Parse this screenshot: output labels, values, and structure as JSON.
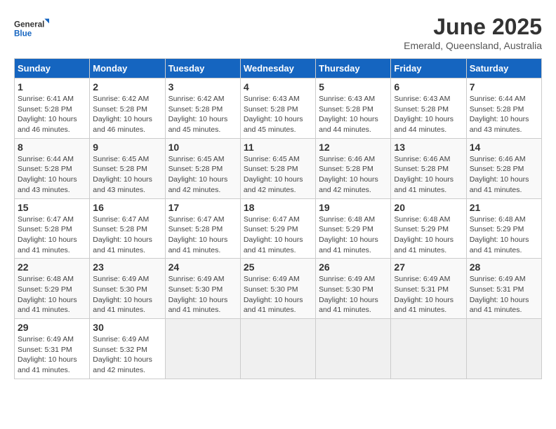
{
  "logo": {
    "general": "General",
    "blue": "Blue"
  },
  "title": "June 2025",
  "location": "Emerald, Queensland, Australia",
  "weekdays": [
    "Sunday",
    "Monday",
    "Tuesday",
    "Wednesday",
    "Thursday",
    "Friday",
    "Saturday"
  ],
  "weeks": [
    [
      {
        "day": "1",
        "sunrise": "6:41 AM",
        "sunset": "5:28 PM",
        "daylight": "10 hours and 46 minutes."
      },
      {
        "day": "2",
        "sunrise": "6:42 AM",
        "sunset": "5:28 PM",
        "daylight": "10 hours and 46 minutes."
      },
      {
        "day": "3",
        "sunrise": "6:42 AM",
        "sunset": "5:28 PM",
        "daylight": "10 hours and 45 minutes."
      },
      {
        "day": "4",
        "sunrise": "6:43 AM",
        "sunset": "5:28 PM",
        "daylight": "10 hours and 45 minutes."
      },
      {
        "day": "5",
        "sunrise": "6:43 AM",
        "sunset": "5:28 PM",
        "daylight": "10 hours and 44 minutes."
      },
      {
        "day": "6",
        "sunrise": "6:43 AM",
        "sunset": "5:28 PM",
        "daylight": "10 hours and 44 minutes."
      },
      {
        "day": "7",
        "sunrise": "6:44 AM",
        "sunset": "5:28 PM",
        "daylight": "10 hours and 43 minutes."
      }
    ],
    [
      {
        "day": "8",
        "sunrise": "6:44 AM",
        "sunset": "5:28 PM",
        "daylight": "10 hours and 43 minutes."
      },
      {
        "day": "9",
        "sunrise": "6:45 AM",
        "sunset": "5:28 PM",
        "daylight": "10 hours and 43 minutes."
      },
      {
        "day": "10",
        "sunrise": "6:45 AM",
        "sunset": "5:28 PM",
        "daylight": "10 hours and 42 minutes."
      },
      {
        "day": "11",
        "sunrise": "6:45 AM",
        "sunset": "5:28 PM",
        "daylight": "10 hours and 42 minutes."
      },
      {
        "day": "12",
        "sunrise": "6:46 AM",
        "sunset": "5:28 PM",
        "daylight": "10 hours and 42 minutes."
      },
      {
        "day": "13",
        "sunrise": "6:46 AM",
        "sunset": "5:28 PM",
        "daylight": "10 hours and 41 minutes."
      },
      {
        "day": "14",
        "sunrise": "6:46 AM",
        "sunset": "5:28 PM",
        "daylight": "10 hours and 41 minutes."
      }
    ],
    [
      {
        "day": "15",
        "sunrise": "6:47 AM",
        "sunset": "5:28 PM",
        "daylight": "10 hours and 41 minutes."
      },
      {
        "day": "16",
        "sunrise": "6:47 AM",
        "sunset": "5:28 PM",
        "daylight": "10 hours and 41 minutes."
      },
      {
        "day": "17",
        "sunrise": "6:47 AM",
        "sunset": "5:28 PM",
        "daylight": "10 hours and 41 minutes."
      },
      {
        "day": "18",
        "sunrise": "6:47 AM",
        "sunset": "5:29 PM",
        "daylight": "10 hours and 41 minutes."
      },
      {
        "day": "19",
        "sunrise": "6:48 AM",
        "sunset": "5:29 PM",
        "daylight": "10 hours and 41 minutes."
      },
      {
        "day": "20",
        "sunrise": "6:48 AM",
        "sunset": "5:29 PM",
        "daylight": "10 hours and 41 minutes."
      },
      {
        "day": "21",
        "sunrise": "6:48 AM",
        "sunset": "5:29 PM",
        "daylight": "10 hours and 41 minutes."
      }
    ],
    [
      {
        "day": "22",
        "sunrise": "6:48 AM",
        "sunset": "5:29 PM",
        "daylight": "10 hours and 41 minutes."
      },
      {
        "day": "23",
        "sunrise": "6:49 AM",
        "sunset": "5:30 PM",
        "daylight": "10 hours and 41 minutes."
      },
      {
        "day": "24",
        "sunrise": "6:49 AM",
        "sunset": "5:30 PM",
        "daylight": "10 hours and 41 minutes."
      },
      {
        "day": "25",
        "sunrise": "6:49 AM",
        "sunset": "5:30 PM",
        "daylight": "10 hours and 41 minutes."
      },
      {
        "day": "26",
        "sunrise": "6:49 AM",
        "sunset": "5:30 PM",
        "daylight": "10 hours and 41 minutes."
      },
      {
        "day": "27",
        "sunrise": "6:49 AM",
        "sunset": "5:31 PM",
        "daylight": "10 hours and 41 minutes."
      },
      {
        "day": "28",
        "sunrise": "6:49 AM",
        "sunset": "5:31 PM",
        "daylight": "10 hours and 41 minutes."
      }
    ],
    [
      {
        "day": "29",
        "sunrise": "6:49 AM",
        "sunset": "5:31 PM",
        "daylight": "10 hours and 41 minutes."
      },
      {
        "day": "30",
        "sunrise": "6:49 AM",
        "sunset": "5:32 PM",
        "daylight": "10 hours and 42 minutes."
      },
      null,
      null,
      null,
      null,
      null
    ]
  ]
}
